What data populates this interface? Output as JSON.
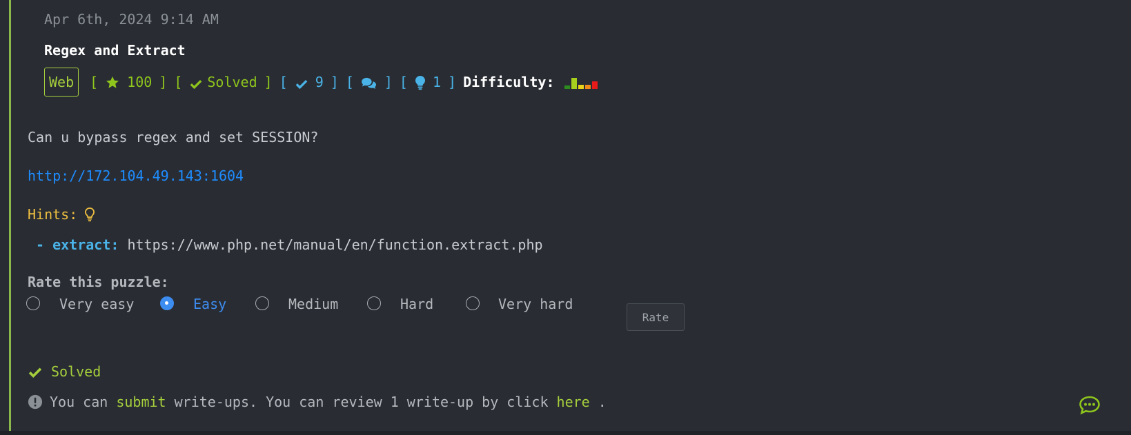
{
  "challenge": {
    "date": "Apr 6th, 2024 9:14 AM",
    "title": "Regex and Extract",
    "category": "Web",
    "points": "100",
    "status": "Solved",
    "solves": "9",
    "hints_count": "1",
    "difficulty_label": "Difficulty:",
    "difficulty_bars": [
      {
        "level": 0.25,
        "color": "#2e8b1f"
      },
      {
        "level": 0.8,
        "color": "#a6cf1e"
      },
      {
        "level": 0.3,
        "color": "#e8d21a"
      },
      {
        "level": 0.3,
        "color": "#f08a1a"
      },
      {
        "level": 0.55,
        "color": "#e81a1a"
      }
    ],
    "description": "Can u bypass regex and set SESSION?",
    "url": "http://172.104.49.143:1604"
  },
  "hints": {
    "label": "Hints:",
    "items": [
      {
        "prefix": "- extract:",
        "text": "https://www.php.net/manual/en/function.extract.php"
      }
    ]
  },
  "rating": {
    "title": "Rate this puzzle:",
    "options": [
      "Very easy",
      "Easy",
      "Medium",
      "Hard",
      "Very hard"
    ],
    "selected": "Easy",
    "button_label": "Rate"
  },
  "footer": {
    "solved_label": "Solved",
    "writeup_pre": "You can",
    "writeup_submit": "submit",
    "writeup_mid": "write-ups. You can review 1 write-up by click",
    "writeup_here": "here",
    "writeup_end": "."
  },
  "colors": {
    "accent_green": "#a6cf3c",
    "accent_blue": "#4ab3e8",
    "link_blue": "#1e8cff",
    "hint_yellow": "#f0c040"
  }
}
